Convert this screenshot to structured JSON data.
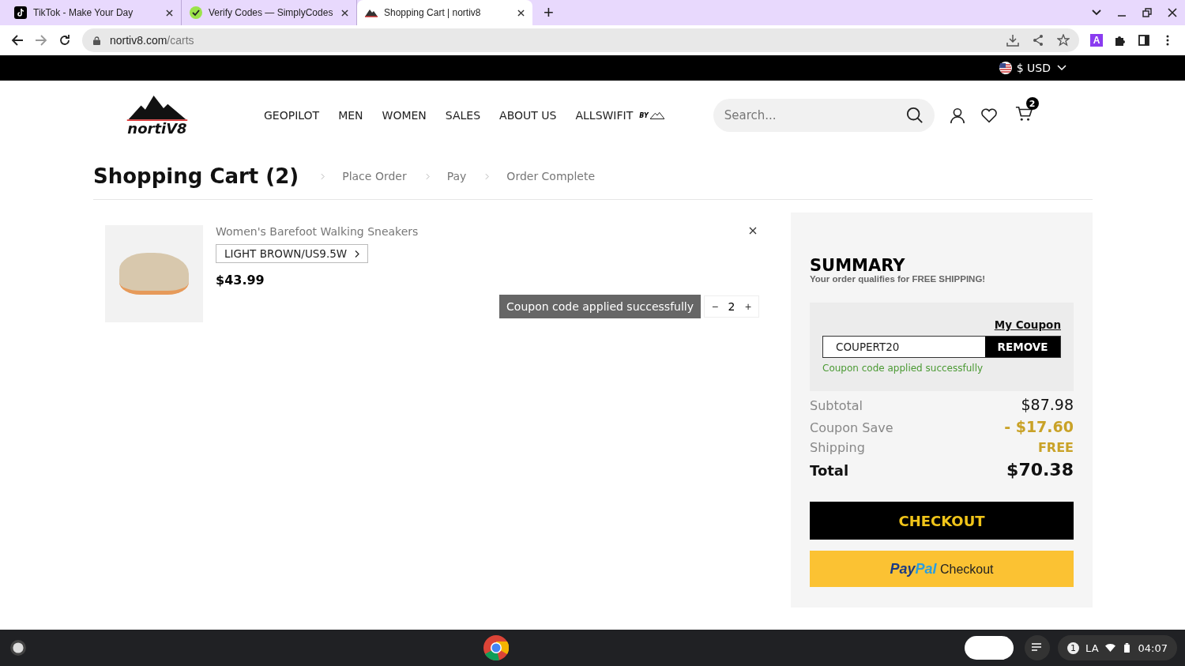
{
  "browser": {
    "tabs": [
      {
        "title": "TikTok - Make Your Day",
        "selected": false
      },
      {
        "title": "Verify Codes — SimplyCodes",
        "selected": false
      },
      {
        "title": "Shopping Cart | nortiv8",
        "selected": true
      }
    ],
    "new_tab": "+",
    "url_host": "nortiv8.com",
    "url_path": "/carts",
    "extension_label": "A"
  },
  "top_bar": {
    "currency": "$ USD"
  },
  "header": {
    "logo": "nortiV8",
    "nav": [
      "GEOPILOT",
      "MEN",
      "WOMEN",
      "SALES",
      "ABOUT US",
      "ALLSWIFIT"
    ],
    "nav_suffix": "BY",
    "search": {
      "placeholder": "Search..."
    },
    "cart_count": "2"
  },
  "page": {
    "title": "Shopping Cart (2)",
    "steps": [
      "Place Order",
      "Pay",
      "Order Complete"
    ]
  },
  "cart_items": [
    {
      "name": "Women's Barefoot Walking Sneakers",
      "variant": "LIGHT BROWN/US9.5W",
      "price": "$43.99",
      "quantity": "2",
      "decrease": "−",
      "increase": "+"
    }
  ],
  "toast": "Coupon code applied successfully",
  "summary": {
    "title": "SUMMARY",
    "subtitle": "Your order qualifies for FREE SHIPPING!",
    "my_coupon": "My Coupon",
    "coupon_value": "COUPERT20",
    "remove": "REMOVE",
    "coupon_message": "Coupon code applied successfully",
    "lines": [
      {
        "label": "Subtotal",
        "value": "$87.98",
        "kind": "normal"
      },
      {
        "label": "Coupon Save",
        "value": "- $17.60",
        "kind": "discount"
      },
      {
        "label": "Shipping",
        "value": "FREE",
        "kind": "free"
      },
      {
        "label": "Total",
        "value": "$70.38",
        "kind": "total"
      }
    ],
    "checkout": "CHECKOUT",
    "paypal_pay": "Pay",
    "paypal_pal": "Pal",
    "paypal_checkout": "Checkout"
  },
  "taskbar": {
    "notification_count": "1",
    "ime": "LA",
    "time": "04:07"
  }
}
